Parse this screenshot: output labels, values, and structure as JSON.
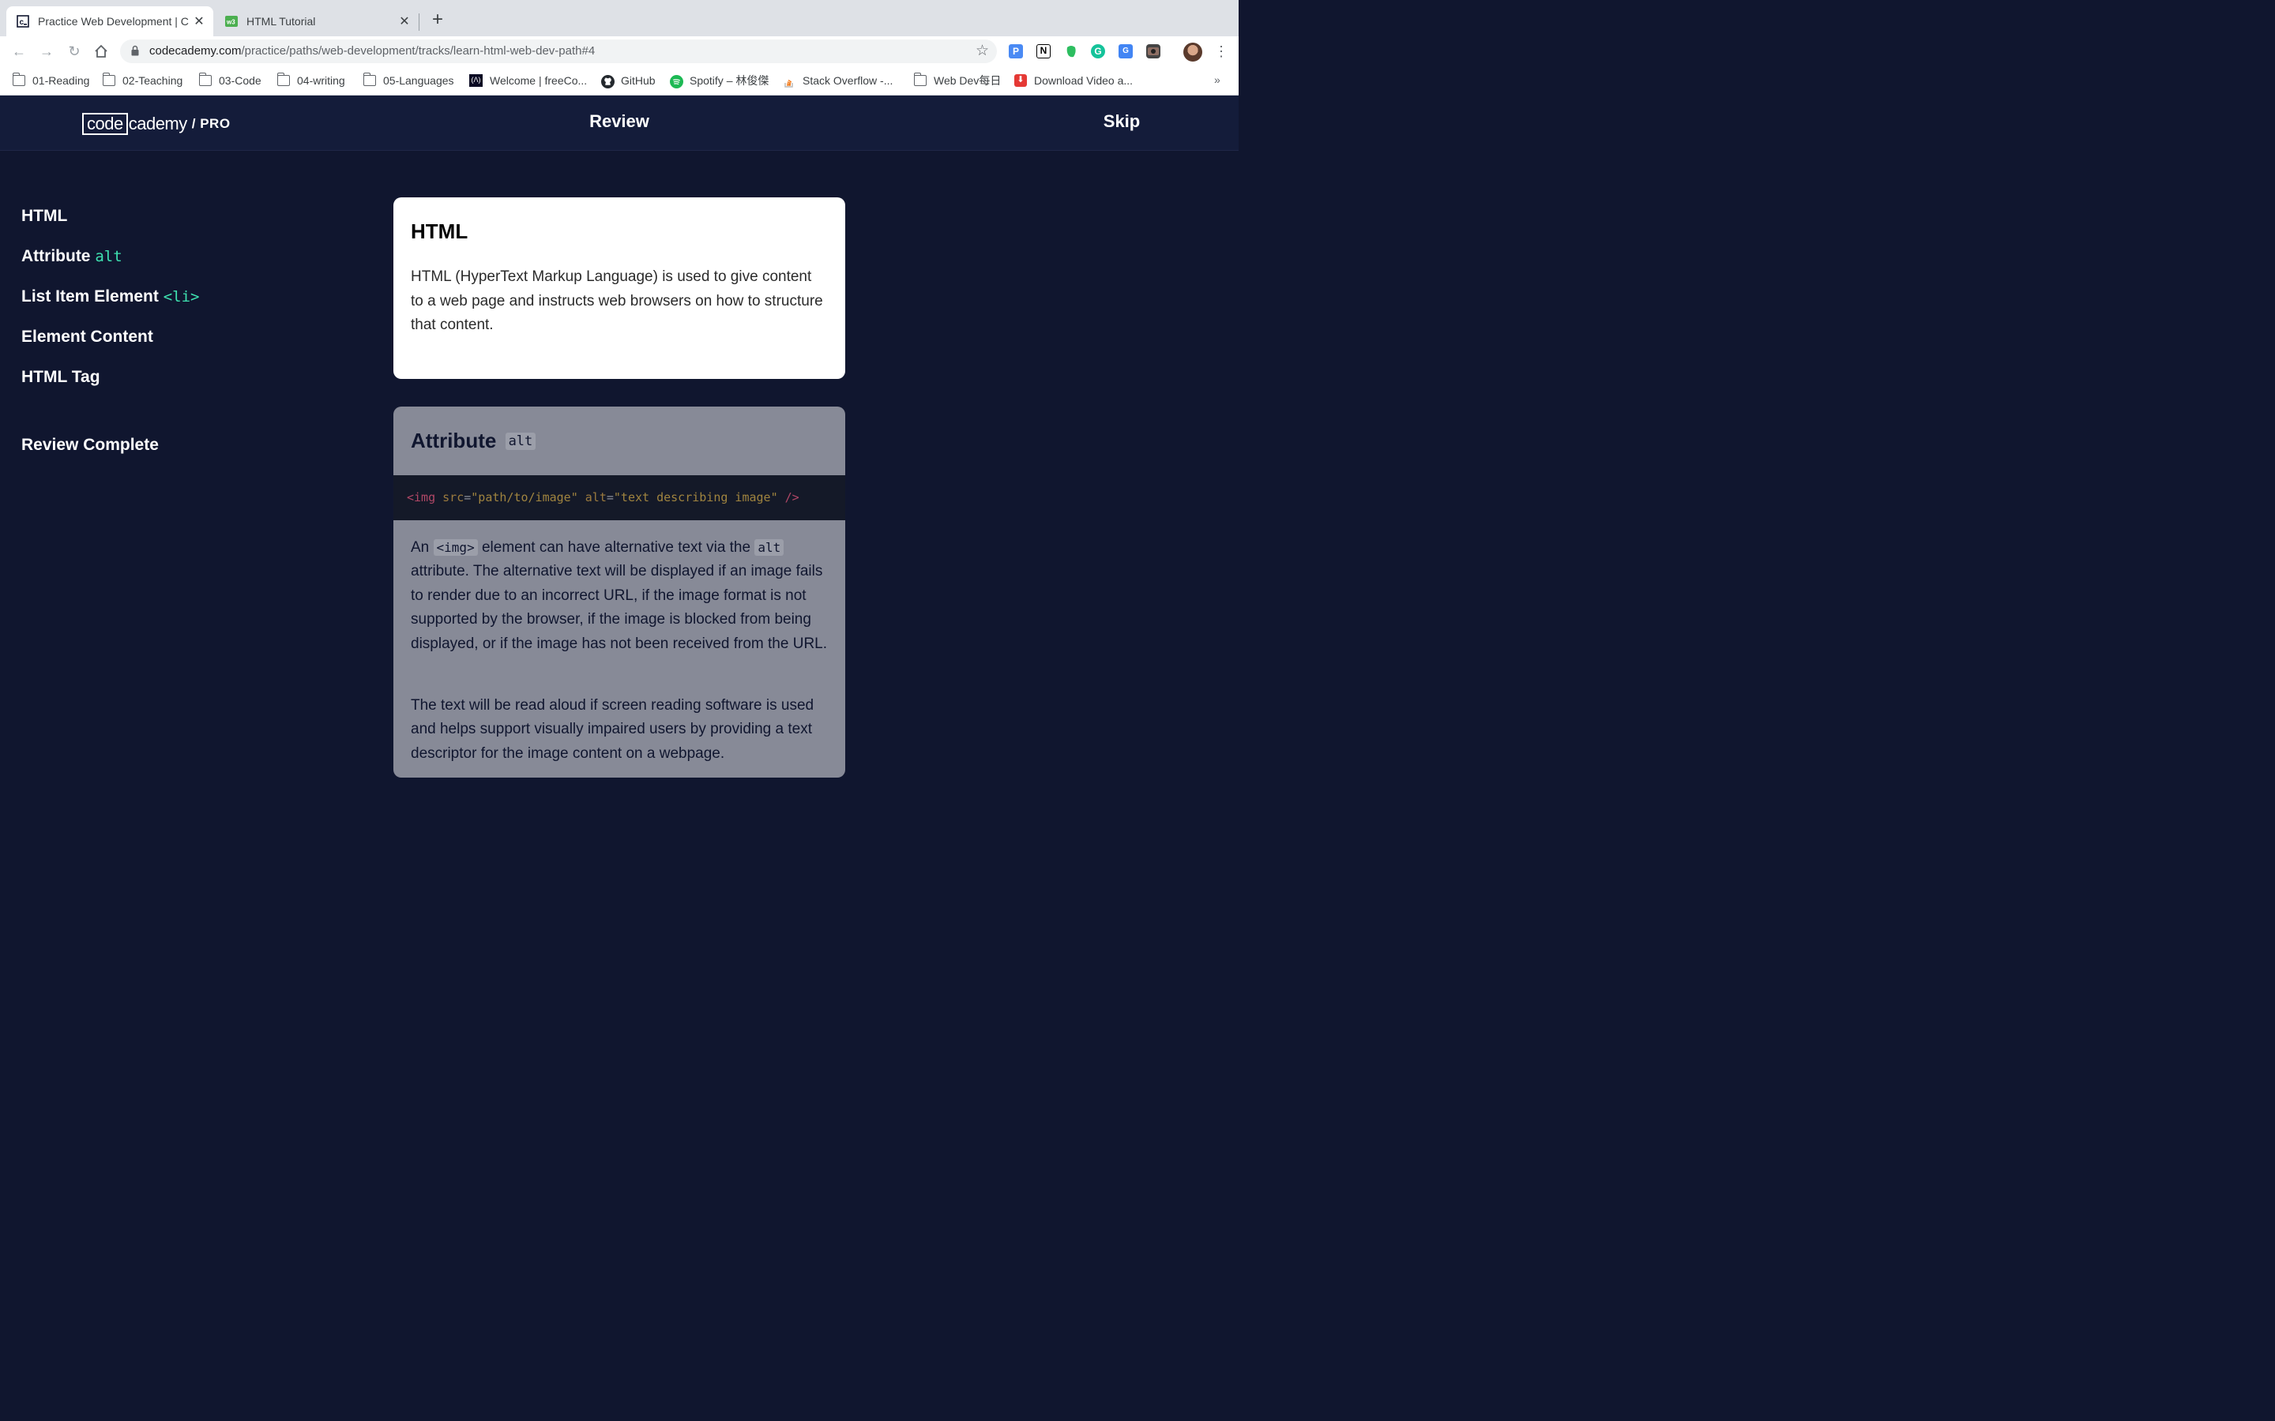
{
  "browser": {
    "tabs": [
      {
        "title": "Practice Web Development | C",
        "active": true,
        "favicon": "codecademy-icon"
      },
      {
        "title": "HTML Tutorial",
        "active": false,
        "favicon": "w3schools-icon"
      }
    ],
    "address": {
      "domain": "codecademy.com",
      "path": "/practice/paths/web-development/tracks/learn-html-web-dev-path#4"
    },
    "bookmarks": [
      {
        "label": "01-Reading",
        "icon": "folder-icon"
      },
      {
        "label": "02-Teaching",
        "icon": "folder-icon"
      },
      {
        "label": "03-Code",
        "icon": "folder-icon"
      },
      {
        "label": "04-writing",
        "icon": "folder-icon"
      },
      {
        "label": "05-Languages",
        "icon": "folder-icon"
      },
      {
        "label": "Welcome | freeCo...",
        "icon": "freecodecamp-icon"
      },
      {
        "label": "GitHub",
        "icon": "github-icon"
      },
      {
        "label": "Spotify – 林俊傑",
        "icon": "spotify-icon"
      },
      {
        "label": "Stack Overflow -...",
        "icon": "stackoverflow-icon"
      },
      {
        "label": "Web Dev每日",
        "icon": "folder-icon"
      },
      {
        "label": "Download Video a...",
        "icon": "download-icon"
      }
    ],
    "more_bookmarks": "»",
    "colors": {
      "tab_bar": "#dee1e6",
      "omnibox": "#f1f3f4"
    }
  },
  "header": {
    "logo_code": "code",
    "logo_cademy": "cademy",
    "logo_pro": "/ PRO",
    "title": "Review",
    "skip": "Skip",
    "bg_color": "#141c3a"
  },
  "sidebar": {
    "items": [
      {
        "label": "HTML",
        "code": ""
      },
      {
        "label": "Attribute ",
        "code": "alt"
      },
      {
        "label": "List Item Element ",
        "code": "<li>"
      },
      {
        "label": "Element Content",
        "code": ""
      },
      {
        "label": "HTML Tag",
        "code": ""
      }
    ],
    "complete": "Review Complete",
    "code_color": "#3ee1b0"
  },
  "cards": {
    "html": {
      "title": "HTML",
      "body": "HTML (HyperText Markup Language) is used to give content to a web page and instructs web browsers on how to structure that content."
    },
    "alt": {
      "title": "Attribute",
      "title_code": "alt",
      "code": {
        "open": "<img",
        "src_attr": " src",
        "src_val": "\"path/to/image\"",
        "alt_attr": " alt",
        "alt_val": "\"text describing image\"",
        "close": " />"
      },
      "para1_a": "An ",
      "para1_code1": "<img>",
      "para1_b": " element can have alternative text via the ",
      "para1_code2": "alt",
      "para1_c": " attribute. The alternative text will be displayed if an image fails to render due to an incorrect URL, if the image format is not supported by the browser, if the image is blocked from being displayed, or if the image has not been received from the URL.",
      "para2": "The text will be read aloud if screen reading software is used and helps support visually impaired users by providing a text descriptor for the image content on a webpage."
    }
  }
}
